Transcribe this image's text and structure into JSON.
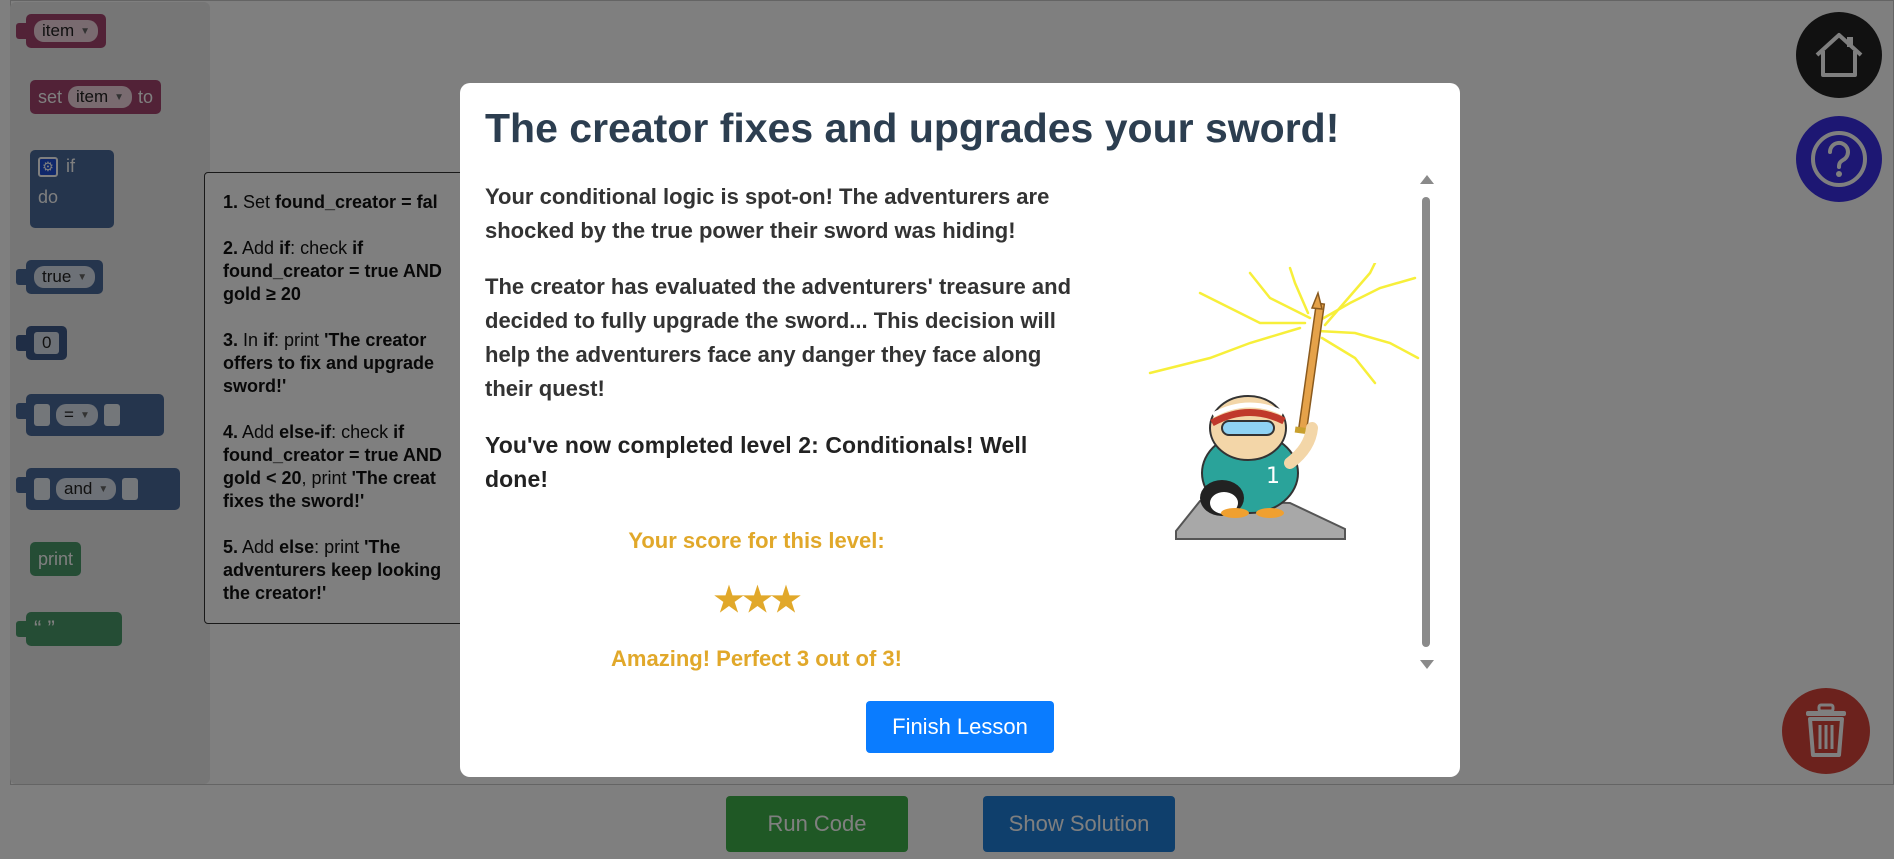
{
  "toolbox": {
    "item_var": "item",
    "set_label": "set",
    "set_var": "item",
    "set_to": "to",
    "if_label": "if",
    "do_label": "do",
    "true_label": "true",
    "zero_label": "0",
    "eq_label": "=",
    "and_label": "and",
    "print_label": "print",
    "quote_label": "“ ”"
  },
  "instructions": {
    "s1_num": "1.",
    "s1_text": " Set ",
    "s1_code": "found_creator = fal",
    "s2_num": "2.",
    "s2_a": " Add ",
    "s2_if": "if",
    "s2_b": ": check ",
    "s2_if2": "if",
    "s2_line2": "found_creator = true AND",
    "s2_line3": "gold ≥ 20",
    "s3_num": "3.",
    "s3_a": " In ",
    "s3_if": "if",
    "s3_b": ": print ",
    "s3_q": "'The creator",
    "s3_line2": "offers to fix and upgrade",
    "s3_line3": "sword!'",
    "s4_num": "4.",
    "s4_a": " Add ",
    "s4_elif": "else-if",
    "s4_b": ": check ",
    "s4_if": "if",
    "s4_line2": "found_creator = true AND",
    "s4_line3a": "gold < 20",
    "s4_line3b": ", print ",
    "s4_line3c": "'The creat",
    "s4_line4": "fixes the sword!'",
    "s5_num": "5.",
    "s5_a": " Add ",
    "s5_else": "else",
    "s5_b": ": print ",
    "s5_q": "'The",
    "s5_line2": "adventurers keep looking",
    "s5_line3": "the creator!'"
  },
  "buttons": {
    "run": "Run Code",
    "solution": "Show Solution"
  },
  "modal": {
    "title": "The creator fixes and upgrades your sword!",
    "p1": "Your conditional logic is spot-on! The adventurers are shocked by the true power their sword was hiding!",
    "p2": "The creator has evaluated the adventurers' treasure and decided to fully upgrade the sword... This decision will help the adventurers face any danger they face along their quest!",
    "p3": "You've now completed level 2: Conditionals! Well done!",
    "score_label": "Your score for this level:",
    "stars": "★★★",
    "score_message": "Amazing! Perfect 3 out of 3!",
    "finish": "Finish Lesson",
    "rating": 3,
    "rating_max": 3
  },
  "icons": [
    "home-icon",
    "help-icon",
    "trash-icon",
    "gear-icon"
  ],
  "colors": {
    "accent_blue": "#0a7cff",
    "score_gold": "#e1a82a",
    "title": "#2c3e50",
    "run_green": "#3fb04a",
    "solution_blue": "#1f7ed8",
    "trash_red": "#d9453a",
    "help_purple": "#3b2ee6"
  }
}
